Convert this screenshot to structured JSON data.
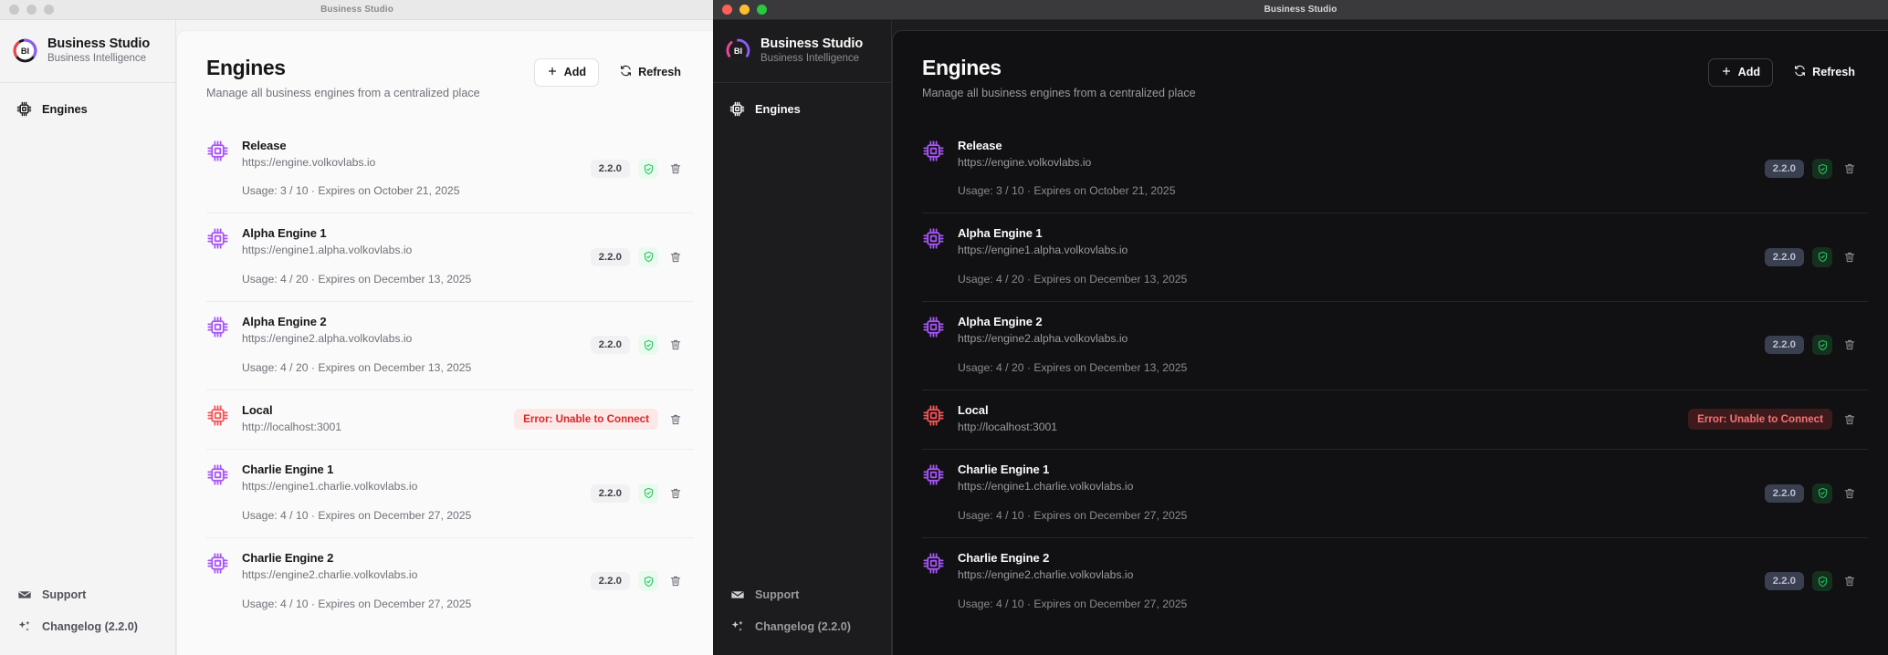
{
  "windows": {
    "light": {
      "titlebar_title": "Business Studio",
      "traffic_lights": [
        "close",
        "minimize",
        "maximize"
      ]
    },
    "dark": {
      "titlebar_title": "Business Studio",
      "traffic_lights": [
        "close",
        "minimize",
        "maximize"
      ]
    }
  },
  "sidebar": {
    "brand": {
      "logo_icon": "bi-logo-icon",
      "name": "Business Studio",
      "subtitle": "Business Intelligence"
    },
    "nav": [
      {
        "icon": "cpu-icon",
        "label": "Engines",
        "active": true
      }
    ],
    "footer": [
      {
        "icon": "envelope-icon",
        "label": "Support"
      },
      {
        "icon": "sparkles-icon",
        "label": "Changelog (2.2.0)"
      }
    ]
  },
  "page": {
    "title": "Engines",
    "subtitle": "Manage all business engines from a centralized place",
    "actions": [
      {
        "icon": "plus-icon",
        "label": "Add",
        "style": "outline"
      },
      {
        "icon": "refresh-icon",
        "label": "Refresh",
        "style": "ghost"
      }
    ]
  },
  "engines": [
    {
      "icon": "cpu-icon",
      "status": "ok",
      "name": "Release",
      "url": "https://engine.volkovlabs.io",
      "meta": "Usage: 3 / 10  ·  Expires on October 21, 2025",
      "version": "2.2.0",
      "shield_icon": "shield-check-icon",
      "delete_icon": "trash-icon"
    },
    {
      "icon": "cpu-icon",
      "status": "ok",
      "name": "Alpha Engine 1",
      "url": "https://engine1.alpha.volkovlabs.io",
      "meta": "Usage: 4 / 20  ·  Expires on December 13, 2025",
      "version": "2.2.0",
      "shield_icon": "shield-check-icon",
      "delete_icon": "trash-icon"
    },
    {
      "icon": "cpu-icon",
      "status": "ok",
      "name": "Alpha Engine 2",
      "url": "https://engine2.alpha.volkovlabs.io",
      "meta": "Usage: 4 / 20  ·  Expires on December 13, 2025",
      "version": "2.2.0",
      "shield_icon": "shield-check-icon",
      "delete_icon": "trash-icon"
    },
    {
      "icon": "cpu-icon",
      "status": "error",
      "name": "Local",
      "url": "http://localhost:3001",
      "meta": "",
      "error_text": "Error: Unable to Connect",
      "delete_icon": "trash-icon"
    },
    {
      "icon": "cpu-icon",
      "status": "ok",
      "name": "Charlie Engine 1",
      "url": "https://engine1.charlie.volkovlabs.io",
      "meta": "Usage: 4 / 10  ·  Expires on December 27, 2025",
      "version": "2.2.0",
      "shield_icon": "shield-check-icon",
      "delete_icon": "trash-icon"
    },
    {
      "icon": "cpu-icon",
      "status": "ok",
      "name": "Charlie Engine 2",
      "url": "https://engine2.charlie.volkovlabs.io",
      "meta": "Usage: 4 / 10  ·  Expires on December 27, 2025",
      "version": "2.2.0",
      "shield_icon": "shield-check-icon",
      "delete_icon": "trash-icon"
    }
  ],
  "colors": {
    "engine_purple": "#a855f7",
    "engine_error_red": "#f4555a",
    "status_green": "#22c55e",
    "error_red": "#dc2626",
    "logo_purple": "#8b5cf6",
    "logo_pink": "#ec4899",
    "logo_red": "#ef4444"
  }
}
